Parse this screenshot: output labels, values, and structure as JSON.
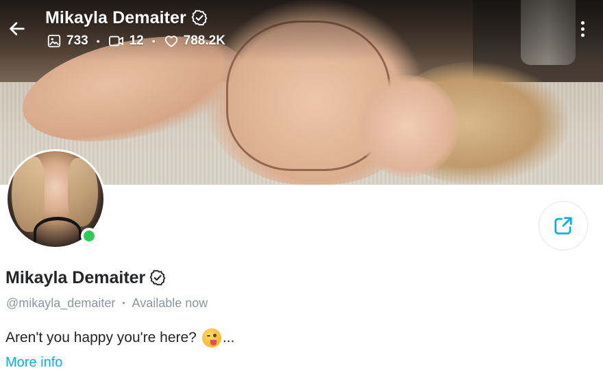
{
  "header": {
    "back_icon": "arrow-left-icon",
    "name": "Mikayla Demaiter",
    "verified_icon": "verified-badge-icon",
    "stats": [
      {
        "icon": "image-icon",
        "value": "733"
      },
      {
        "icon": "video-icon",
        "value": "12"
      },
      {
        "icon": "heart-icon",
        "value": "788.2K"
      }
    ],
    "more_icon": "more-vertical-icon"
  },
  "profile": {
    "name": "Mikayla Demaiter",
    "handle": "@mikayla_demaiter",
    "status": "Available now",
    "online": true,
    "bio_text": "Aren't you happy you're here?",
    "bio_emoji": "face-savoring-food-emoji",
    "bio_ellipsis": "...",
    "more_info_label": "More info",
    "share_icon": "share-icon"
  },
  "colors": {
    "accent": "#00aff0",
    "online": "#2ecc55",
    "muted_text": "#8a96a3",
    "primary_text": "#242529"
  }
}
